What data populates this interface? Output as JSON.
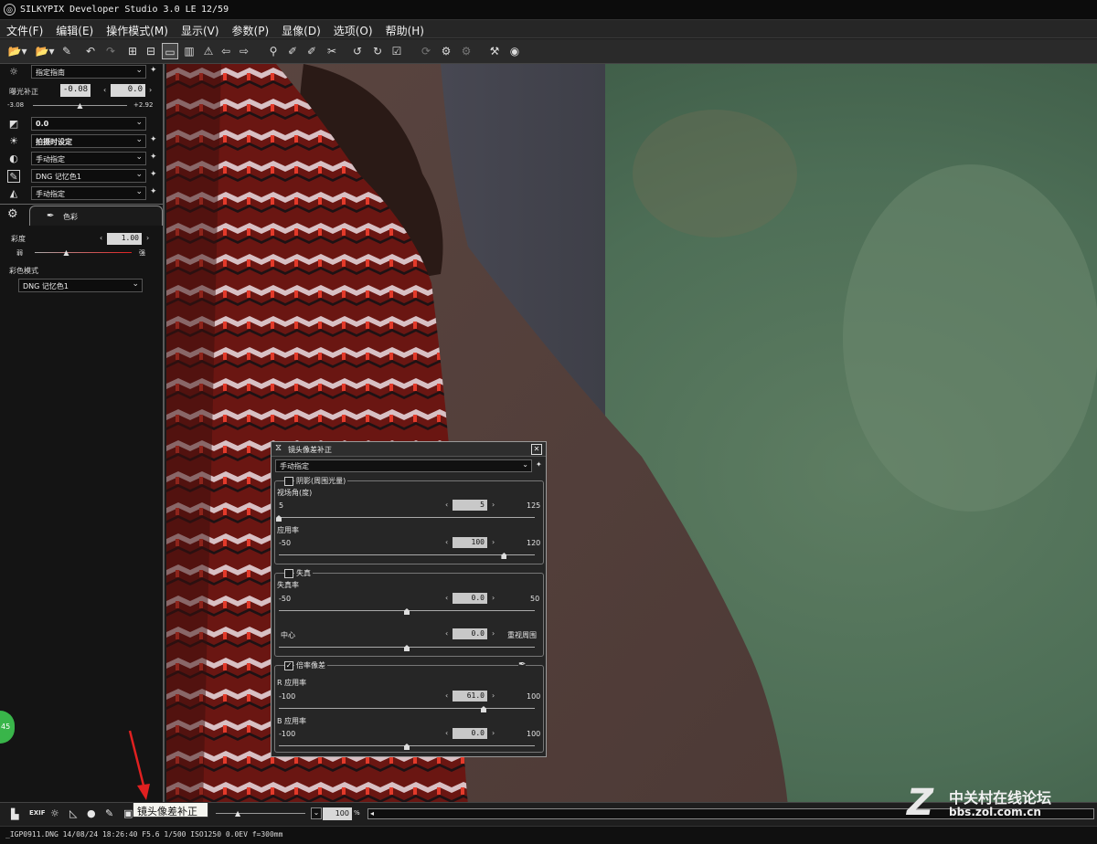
{
  "window": {
    "title": "SILKYPIX Developer Studio 3.0 LE",
    "counter": "12/59"
  },
  "menu": [
    "文件(F)",
    "编辑(E)",
    "操作模式(M)",
    "显示(V)",
    "参数(P)",
    "显像(D)",
    "选项(O)",
    "帮助(H)"
  ],
  "left_panel": {
    "taste": "指定指南",
    "exposure_label": "曝光补正",
    "exposure_value": "-0.08",
    "exposure_value2": "0.0",
    "exposure_min": "-3.08",
    "exposure_max": "+2.92",
    "exposure_level": 0.5,
    "tone": "0.0",
    "white_balance": "拍摄时设定",
    "contrast": "手动指定",
    "color": "DNG 记忆色1",
    "sharpness": "手动指定",
    "color_tab": "色彩",
    "saturation_label": "彩度",
    "saturation_value": "1.00",
    "saturation_weak": "弱",
    "saturation_strong": "强",
    "color_mode_label": "彩色模式",
    "color_mode_value": "DNG 记忆色1"
  },
  "dialog": {
    "title": "镜头像差补正",
    "mode": "手动指定",
    "vignetting": {
      "label": "阴影(周围光量)",
      "checked": false,
      "angle_label": "视场角(度)",
      "angle_min": "5",
      "angle_value": "5",
      "angle_max": "125",
      "angle_level": 0.0,
      "rate_label": "应用率",
      "rate_min": "-50",
      "rate_value": "100",
      "rate_max": "120",
      "rate_level": 0.88
    },
    "distortion": {
      "label": "失真",
      "checked": false,
      "rate_label": "失真率",
      "rate_min": "-50",
      "rate_value": "0.0",
      "rate_max": "50",
      "rate_level": 0.5,
      "center_label": "中心",
      "center_value": "0.0",
      "center_right": "重视周围",
      "center_level": 0.5
    },
    "chromatic": {
      "label": "倍率像差",
      "checked": true,
      "r_label": "R 应用率",
      "r_min": "-100",
      "r_value": "61.0",
      "r_max": "100",
      "r_level": 0.8,
      "b_label": "B 应用率",
      "b_min": "-100",
      "b_value": "0.0",
      "b_max": "100",
      "b_level": 0.5
    }
  },
  "bottom": {
    "zoom": "100",
    "zoom_unit": "%",
    "tooltip": "镜头像差补正"
  },
  "status": "_IGP0911.DNG 14/08/24 18:26:40 F5.6 1/500 ISO1250 0.0EV f=300mm",
  "watermark": {
    "line1": "中关村在线论坛",
    "line2": "bbs.zol.com.cn",
    "logo": "Z"
  },
  "badge": "45",
  "colors": {
    "accent_red": "#e02020",
    "panel_bg": "#141414"
  }
}
